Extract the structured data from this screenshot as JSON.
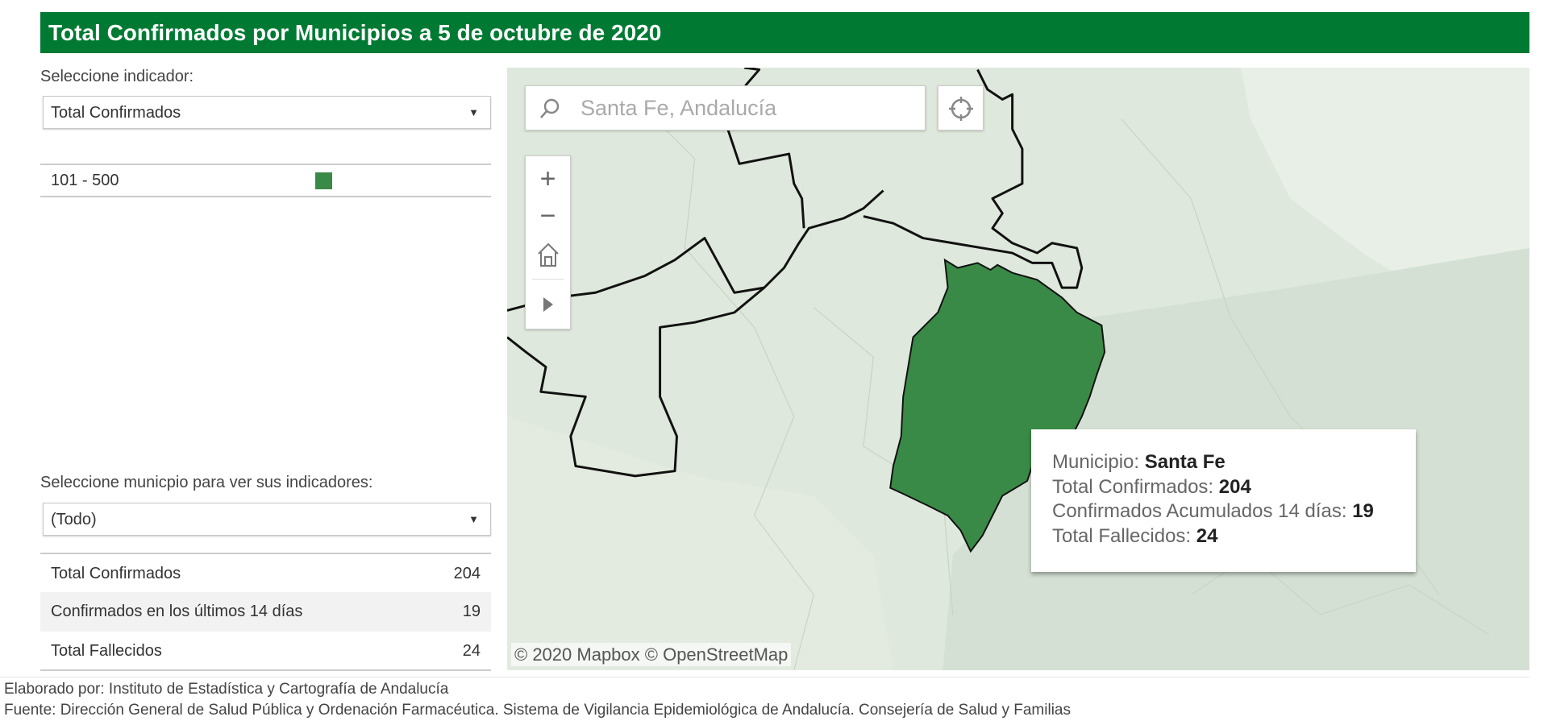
{
  "header": {
    "title": "Total Confirmados por Municipios a 5 de octubre de 2020",
    "color": "#007a33"
  },
  "indicator": {
    "label": "Seleccione indicador:",
    "selected": "Total Confirmados"
  },
  "legend": {
    "items": [
      {
        "label": "101 - 500",
        "color": "#3a8a47"
      }
    ]
  },
  "municipality": {
    "label": "Seleccione municpio para ver sus indicadores:",
    "selected": "(Todo)"
  },
  "stats": [
    {
      "label": "Total Confirmados",
      "value": "204"
    },
    {
      "label": "Confirmados en los últimos 14 días",
      "value": "19"
    },
    {
      "label": "Total Fallecidos",
      "value": "24"
    }
  ],
  "map": {
    "search_value": "Santa Fe, Andalucía",
    "attribution": "© 2020 Mapbox  © OpenStreetMap",
    "highlight_color": "#3a8a47",
    "controls": [
      "zoom-in",
      "zoom-out",
      "home",
      "play"
    ]
  },
  "tooltip": {
    "municipio_label": "Municipio: ",
    "municipio": "Santa Fe",
    "confirmados_label": "Total Confirmados: ",
    "confirmados": "204",
    "acumulados_label": "Confirmados Acumulados 14 días: ",
    "acumulados": "19",
    "fallecidos_label": "Total Fallecidos: ",
    "fallecidos": "24"
  },
  "footer": {
    "line1": "Elaborado por: Instituto de Estadística y Cartografía de Andalucía",
    "line2": "Fuente: Dirección General de Salud Pública y Ordenación Farmacéutica. Sistema de Vigilancia Epidemiológica de Andalucía. Consejería de Salud y Familias"
  }
}
